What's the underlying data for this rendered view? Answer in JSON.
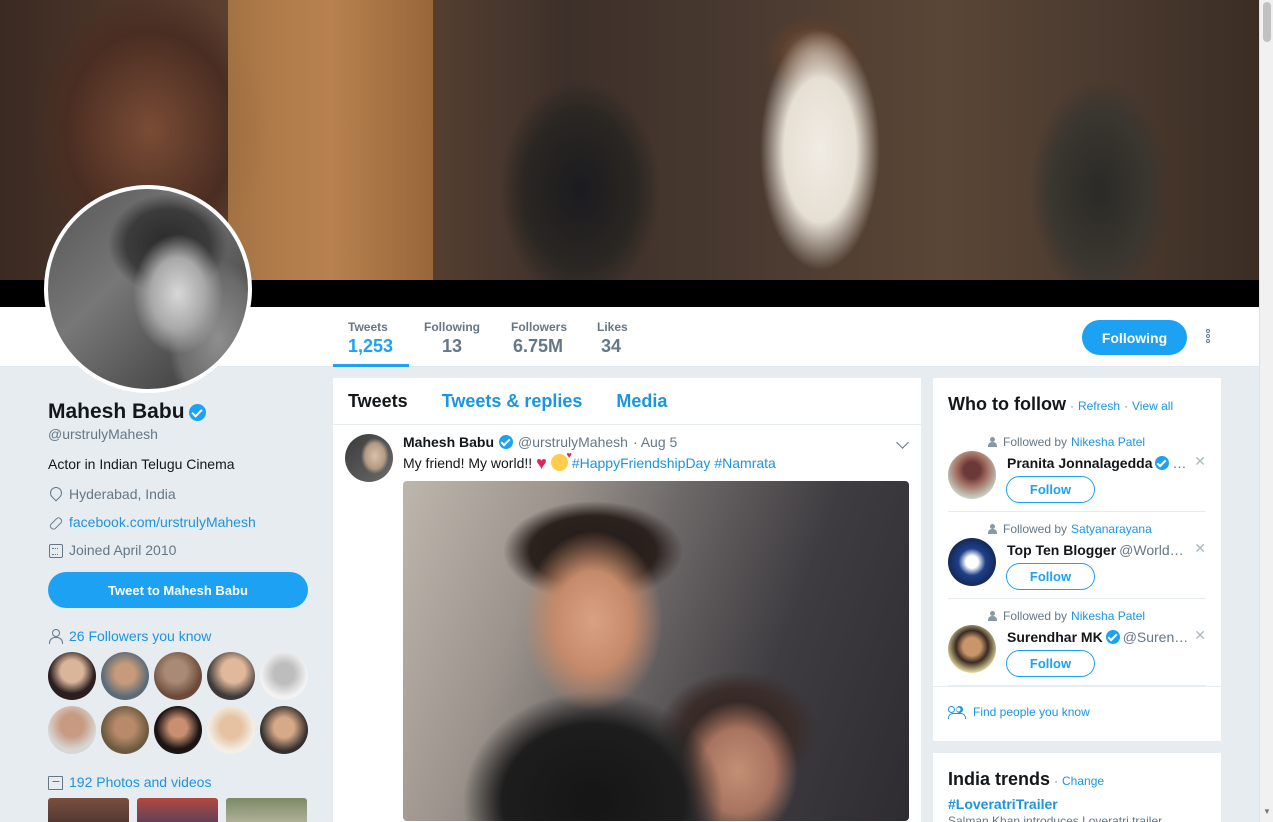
{
  "profile": {
    "name": "Mahesh Babu",
    "handle": "@urstrulyMahesh",
    "bio": "Actor in Indian Telugu Cinema",
    "location": "Hyderabad, India",
    "website": "facebook.com/urstrulyMahesh",
    "joined": "Joined April 2010",
    "tweet_to_label": "Tweet to Mahesh Babu",
    "followers_you_know": "26 Followers you know",
    "photos_videos": "192 Photos and videos"
  },
  "stats": [
    {
      "label": "Tweets",
      "value": "1,253"
    },
    {
      "label": "Following",
      "value": "13"
    },
    {
      "label": "Followers",
      "value": "6.75M"
    },
    {
      "label": "Likes",
      "value": "34"
    }
  ],
  "nav": {
    "following_label": "Following"
  },
  "tabs": [
    "Tweets",
    "Tweets & replies",
    "Media"
  ],
  "tweet": {
    "name": "Mahesh Babu",
    "handle": "@urstrulyMahesh",
    "date": "· Aug 5",
    "text": "My friend! My world!!",
    "hashtag1": "#HappyFriendshipDay",
    "hashtag2": "#Namrata"
  },
  "who_to_follow": {
    "title": "Who to follow",
    "refresh": "Refresh",
    "view_all": "View all",
    "find_people": "Find people you know",
    "suggestions": [
      {
        "followed_by_prefix": "Followed by",
        "followed_by": "Nikesha Patel",
        "name": "Pranita Jonnalagedda",
        "handle": "…",
        "verified": true,
        "follow_label": "Follow"
      },
      {
        "followed_by_prefix": "Followed by",
        "followed_by": "Satyanarayana",
        "name": "Top Ten Blogger",
        "handle": "@World…",
        "verified": false,
        "follow_label": "Follow"
      },
      {
        "followed_by_prefix": "Followed by",
        "followed_by": "Nikesha Patel",
        "name": "Surendhar MK",
        "handle": "@Suren…",
        "verified": true,
        "follow_label": "Follow"
      }
    ]
  },
  "trends": {
    "title": "India trends",
    "change": "Change",
    "items": [
      {
        "tag": "#LoveratriTrailer",
        "desc": "Salman Khan introduces Loveratri trailer"
      }
    ]
  },
  "colors": {
    "accent": "#1da1f2",
    "link": "#1b95e0",
    "muted": "#657786",
    "background": "#e6ecf0"
  }
}
